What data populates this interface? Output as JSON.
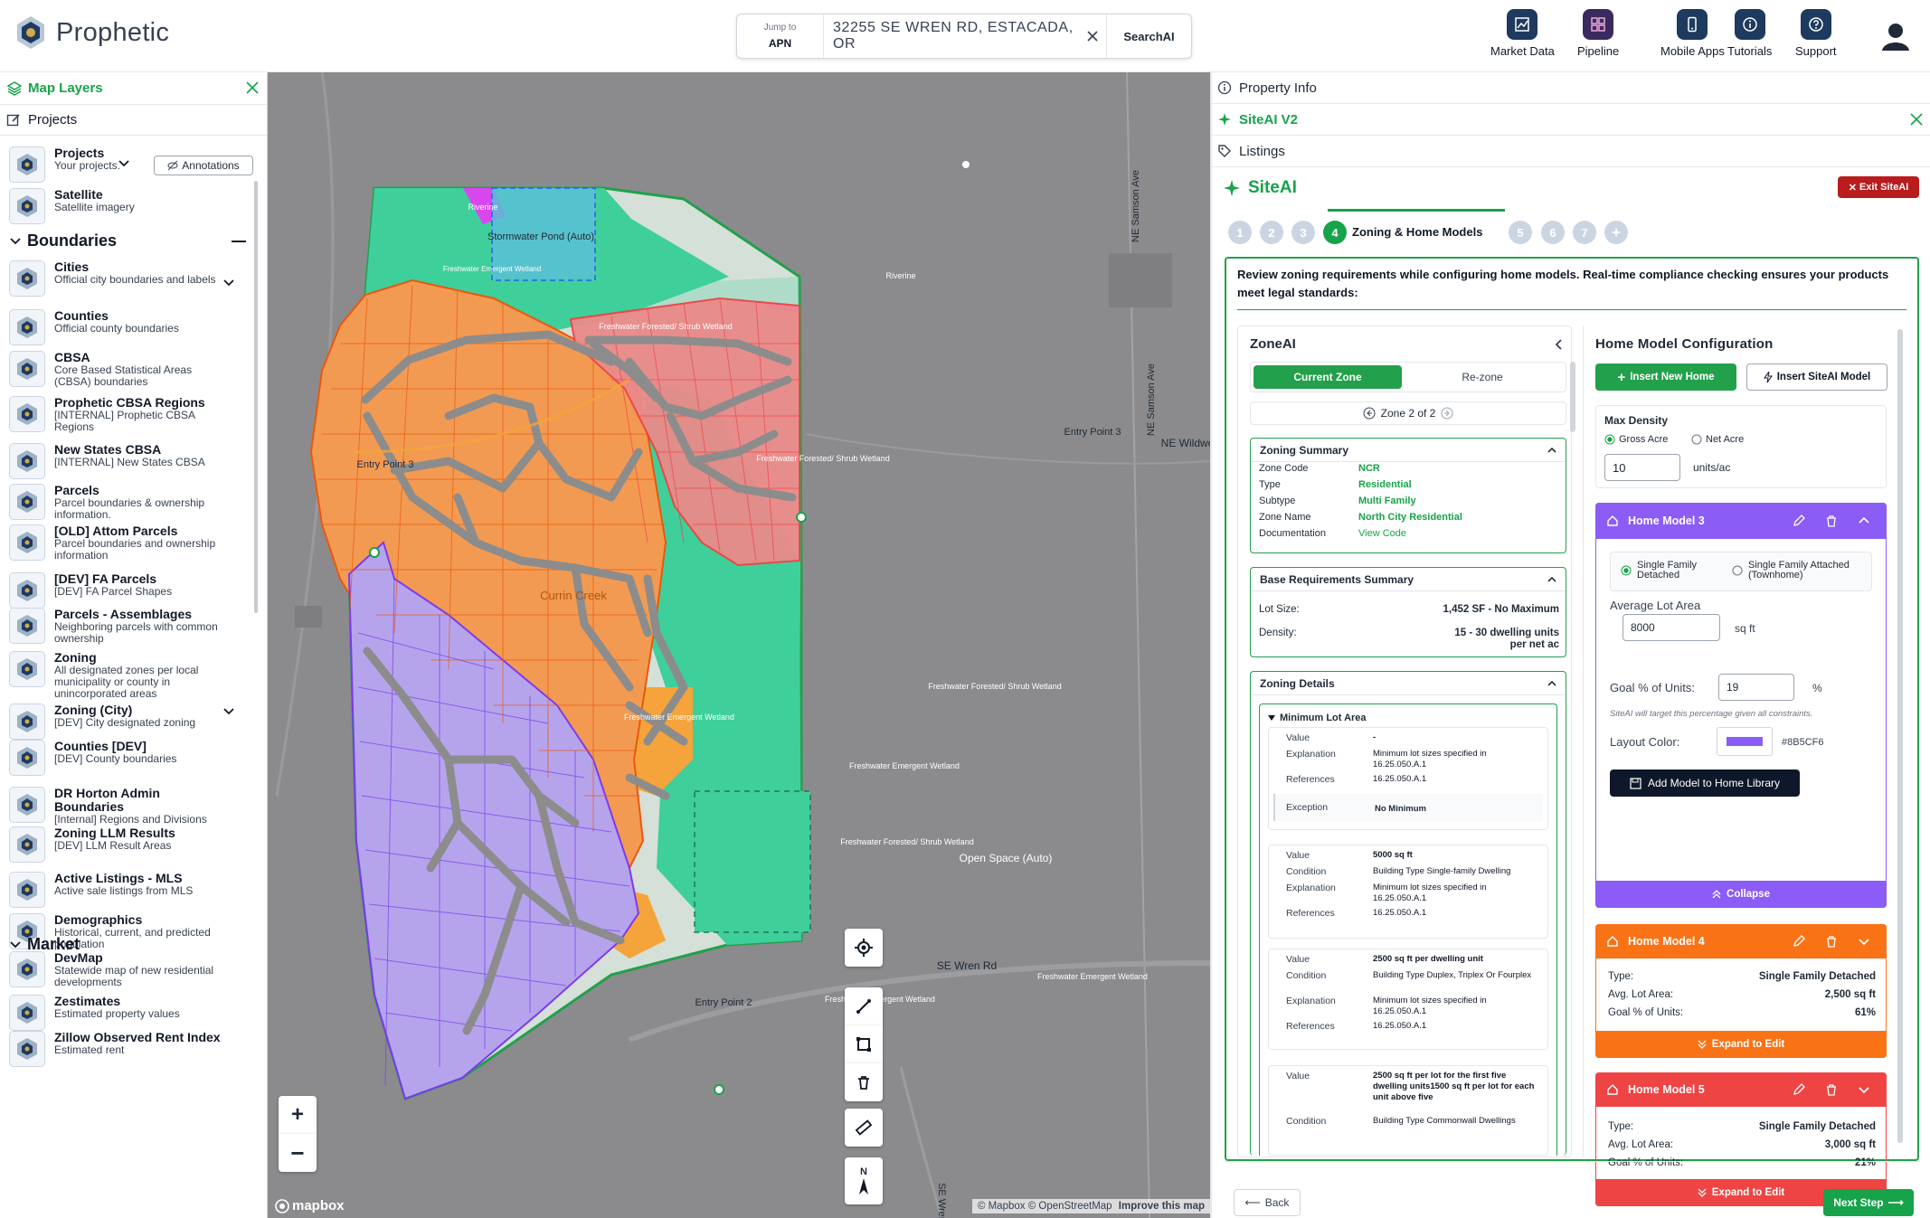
{
  "header": {
    "brand": "Prophetic",
    "search": {
      "jump_label": "Jump to",
      "jump_value": "APN",
      "address": "32255 SE WREN RD, ESTACADA, OR",
      "search_button": "SearchAI"
    },
    "nav": [
      {
        "label": "Market Data",
        "icon": "chart-icon"
      },
      {
        "label": "Pipeline",
        "icon": "grid-icon"
      },
      {
        "label": "Mobile Apps",
        "icon": "phone-icon"
      },
      {
        "label": "Tutorials",
        "icon": "info-icon"
      },
      {
        "label": "Support",
        "icon": "help-icon"
      }
    ]
  },
  "left_panel": {
    "title": "Map Layers",
    "projects_link": "Projects",
    "annotations_button": "Annotations",
    "sections": {
      "boundaries": "Boundaries",
      "market": "Market"
    },
    "layers": [
      {
        "title": "Projects",
        "desc": "Your projects."
      },
      {
        "title": "Satellite",
        "desc": "Satellite imagery"
      },
      {
        "title": "Cities",
        "desc": "Official city boundaries and labels"
      },
      {
        "title": "Counties",
        "desc": "Official county boundaries"
      },
      {
        "title": "CBSA",
        "desc": "Core Based Statistical Areas (CBSA) boundaries"
      },
      {
        "title": "Prophetic CBSA Regions",
        "desc": "[INTERNAL] Prophetic CBSA Regions"
      },
      {
        "title": "New States CBSA",
        "desc": "[INTERNAL] New States CBSA"
      },
      {
        "title": "Parcels",
        "desc": "Parcel boundaries & ownership information."
      },
      {
        "title": "[OLD] Attom Parcels",
        "desc": "Parcel boundaries and ownership information"
      },
      {
        "title": "[DEV] FA Parcels",
        "desc": "[DEV] FA Parcel Shapes"
      },
      {
        "title": "Parcels - Assemblages",
        "desc": "Neighboring parcels with common ownership"
      },
      {
        "title": "Zoning",
        "desc": "All designated zones per local municipality or county in unincorporated areas"
      },
      {
        "title": "Zoning (City)",
        "desc": "[DEV] City designated zoning"
      },
      {
        "title": "Counties [DEV]",
        "desc": "[DEV] County boundaries"
      },
      {
        "title": "DR Horton Admin Boundaries",
        "desc": "[Internal] Regions and Divisions"
      },
      {
        "title": "Zoning LLM Results",
        "desc": "[DEV] LLM Result Areas"
      },
      {
        "title": "Active Listings - MLS",
        "desc": "Active sale listings from MLS"
      },
      {
        "title": "Demographics",
        "desc": "Historical, current, and predicted population"
      },
      {
        "title": "DevMap",
        "desc": "Statewide map of new residential developments"
      },
      {
        "title": "Zestimates",
        "desc": "Estimated property values"
      },
      {
        "title": "Zillow Observed Rent Index",
        "desc": "Estimated rent"
      }
    ]
  },
  "map": {
    "labels": {
      "stormwater": "Stormwater Pond (Auto)",
      "riverine": "Riverine",
      "riverine2": "Riverine",
      "fw_emergent": "Freshwater Emergent Wetland",
      "fw_forested1": "Freshwater Forested/ Shrub Wetland",
      "fw_forested2": "Freshwater Forested/ Shrub Wetland",
      "fw_forested3": "Freshwater Forested/ Shrub Wetland",
      "fw_forested4": "Freshwater Forested/ Shrub Wetland",
      "fw_emergent2": "Freshwater Emergent Wetland",
      "fw_emergent3": "Freshwater Emergent Wetland",
      "fw_emergent4": "Freshwater Emergent Wetland",
      "fw_emergent5": "Freshwater Emergent Wetland",
      "open_space": "Open Space (Auto)",
      "creek": "Currin Creek",
      "entry1": "Entry Point 3",
      "entry2": "Entry Point 2",
      "entry3": "Entry Point 3",
      "road1": "SE Wren Rd",
      "road2": "NE Samson Ave",
      "road3": "NE Samson Ave",
      "road4": "NE Wildwo",
      "road5": "SE Wren"
    },
    "attribution": "© Mapbox © OpenStreetMap",
    "improve": "Improve this map",
    "brand": "mapbox",
    "compass": "N",
    "colors": {
      "orange": "#f97316",
      "red": "#ef4444",
      "purple": "#8b5cf6",
      "green": "#34d399",
      "road": "#8c8c8c"
    }
  },
  "right_panel": {
    "tabs": {
      "property_info": "Property Info",
      "siteai_v2": "SiteAI V2",
      "listings": "Listings"
    },
    "siteai_title": "SiteAI",
    "exit_button": "Exit SiteAI",
    "steps": [
      "1",
      "2",
      "3",
      "4",
      "5",
      "6",
      "7"
    ],
    "active_step_label": "Zoning & Home Models",
    "intro": "Review zoning requirements while configuring home models. Real-time compliance checking ensures your products meet legal standards:",
    "zoneai": {
      "title": "ZoneAI",
      "current_zone": "Current Zone",
      "rezone": "Re-zone",
      "pager": "Zone 2 of 2",
      "summary": {
        "title": "Zoning Summary",
        "rows": [
          {
            "k": "Zone Code",
            "v": "NCR"
          },
          {
            "k": "Type",
            "v": "Residential"
          },
          {
            "k": "Subtype",
            "v": "Multi Family"
          },
          {
            "k": "Zone Name",
            "v": "North City Residential"
          },
          {
            "k": "Documentation",
            "v": "View Code"
          }
        ]
      },
      "base": {
        "title": "Base Requirements Summary",
        "lot_label": "Lot Size:",
        "lot_value": "1,452 SF - No Maximum",
        "density_label": "Density:",
        "density_value": "15 - 30 dwelling units per net ac"
      },
      "details": {
        "title": "Zoning Details",
        "subtitle": "Minimum Lot Area",
        "block1": {
          "value_k": "Value",
          "value_v": "-",
          "expl_k": "Explanation",
          "expl_v": "Minimum lot sizes specified in 16.25.050.A.1",
          "ref_k": "References",
          "ref_v": "16.25.050.A.1",
          "exc_k": "Exception",
          "exc_v": "No Minimum"
        },
        "block2": {
          "value_k": "Value",
          "value_v": "5000 sq ft",
          "cond_k": "Condition",
          "cond_v": "Building Type Single-family Dwelling",
          "expl_k": "Explanation",
          "expl_v": "Minimum lot sizes specified in 16.25.050.A.1",
          "ref_k": "References",
          "ref_v": "16.25.050.A.1"
        },
        "block3": {
          "value_k": "Value",
          "value_v": "2500 sq ft per dwelling unit",
          "cond_k": "Condition",
          "cond_v": "Building Type Duplex, Triplex Or Fourplex",
          "expl_k": "Explanation",
          "expl_v": "Minimum lot sizes specified in 16.25.050.A.1",
          "ref_k": "References",
          "ref_v": "16.25.050.A.1"
        },
        "block4": {
          "value_k": "Value",
          "value_v": "2500 sq ft per lot for the first five dwelling units1500 sq ft per lot for each unit above five",
          "cond_k": "Condition",
          "cond_v": "Building Type Commonwall Dwellings"
        }
      }
    },
    "homemodel": {
      "title": "Home Model Configuration",
      "insert_new": "Insert New Home",
      "insert_siteai": "Insert SiteAI Model",
      "max_density": "Max Density",
      "gross": "Gross Acre",
      "net": "Net Acre",
      "density_value": "10",
      "units": "units/ac",
      "model3": {
        "title": "Home Model 3",
        "opt1": "Single Family Detached",
        "opt2": "Single Family Attached (Townhome)",
        "avg_lot_label": "Average Lot Area",
        "avg_lot_value": "8000",
        "sqft": "sq ft",
        "goal_label": "Goal % of Units:",
        "goal_value": "19",
        "pct": "%",
        "hint": "SiteAI will target this percentage given all constraints.",
        "color_label": "Layout Color:",
        "color_hex": "#8B5CF6",
        "add_button": "Add Model to Home Library",
        "collapse": "Collapse"
      },
      "model4": {
        "title": "Home Model 4",
        "type_k": "Type:",
        "type_v": "Single Family Detached",
        "lot_k": "Avg. Lot Area:",
        "lot_v": "2,500 sq ft",
        "goal_k": "Goal % of Units:",
        "goal_v": "61%",
        "expand": "Expand to Edit"
      },
      "model5": {
        "title": "Home Model 5",
        "type_k": "Type:",
        "type_v": "Single Family Detached",
        "lot_k": "Avg. Lot Area:",
        "lot_v": "3,000 sq ft",
        "goal_k": "Goal % of Units:",
        "goal_v": "21%",
        "expand": "Expand to Edit"
      }
    },
    "footer": {
      "back": "Back",
      "next": "Next Step"
    }
  }
}
